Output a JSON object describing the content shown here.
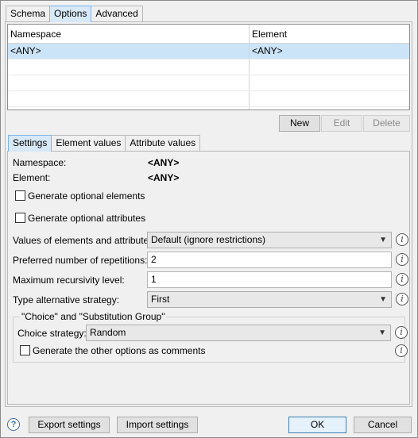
{
  "top_tabs": [
    "Schema",
    "Options",
    "Advanced"
  ],
  "namespace_table": {
    "headers": [
      "Namespace",
      "Element"
    ],
    "rows": [
      [
        "<ANY>",
        "<ANY>"
      ]
    ]
  },
  "table_buttons": {
    "new": "New",
    "edit": "Edit",
    "delete": "Delete"
  },
  "inner_tabs": [
    "Settings",
    "Element values",
    "Attribute values"
  ],
  "settings": {
    "namespace_label": "Namespace:",
    "namespace_value": "<ANY>",
    "element_label": "Element:",
    "element_value": "<ANY>",
    "gen_optional_elements": "Generate optional elements",
    "gen_optional_attributes": "Generate optional attributes",
    "values_label": "Values of elements and attributes:",
    "values_selected": "Default (ignore restrictions)",
    "repetitions_label": "Preferred number of repetitions:",
    "repetitions_value": "2",
    "recursivity_label": "Maximum recursivity level:",
    "recursivity_value": "1",
    "type_alt_label": "Type alternative strategy:",
    "type_alt_selected": "First",
    "group_title": "\"Choice\" and \"Substitution Group\"",
    "choice_label": "Choice strategy:",
    "choice_selected": "Random",
    "gen_other_options": "Generate the other options as comments"
  },
  "footer": {
    "export": "Export settings",
    "import": "Import settings",
    "ok": "OK",
    "cancel": "Cancel"
  },
  "icons": {
    "info": "i",
    "help": "?",
    "dropdown": "▼"
  }
}
